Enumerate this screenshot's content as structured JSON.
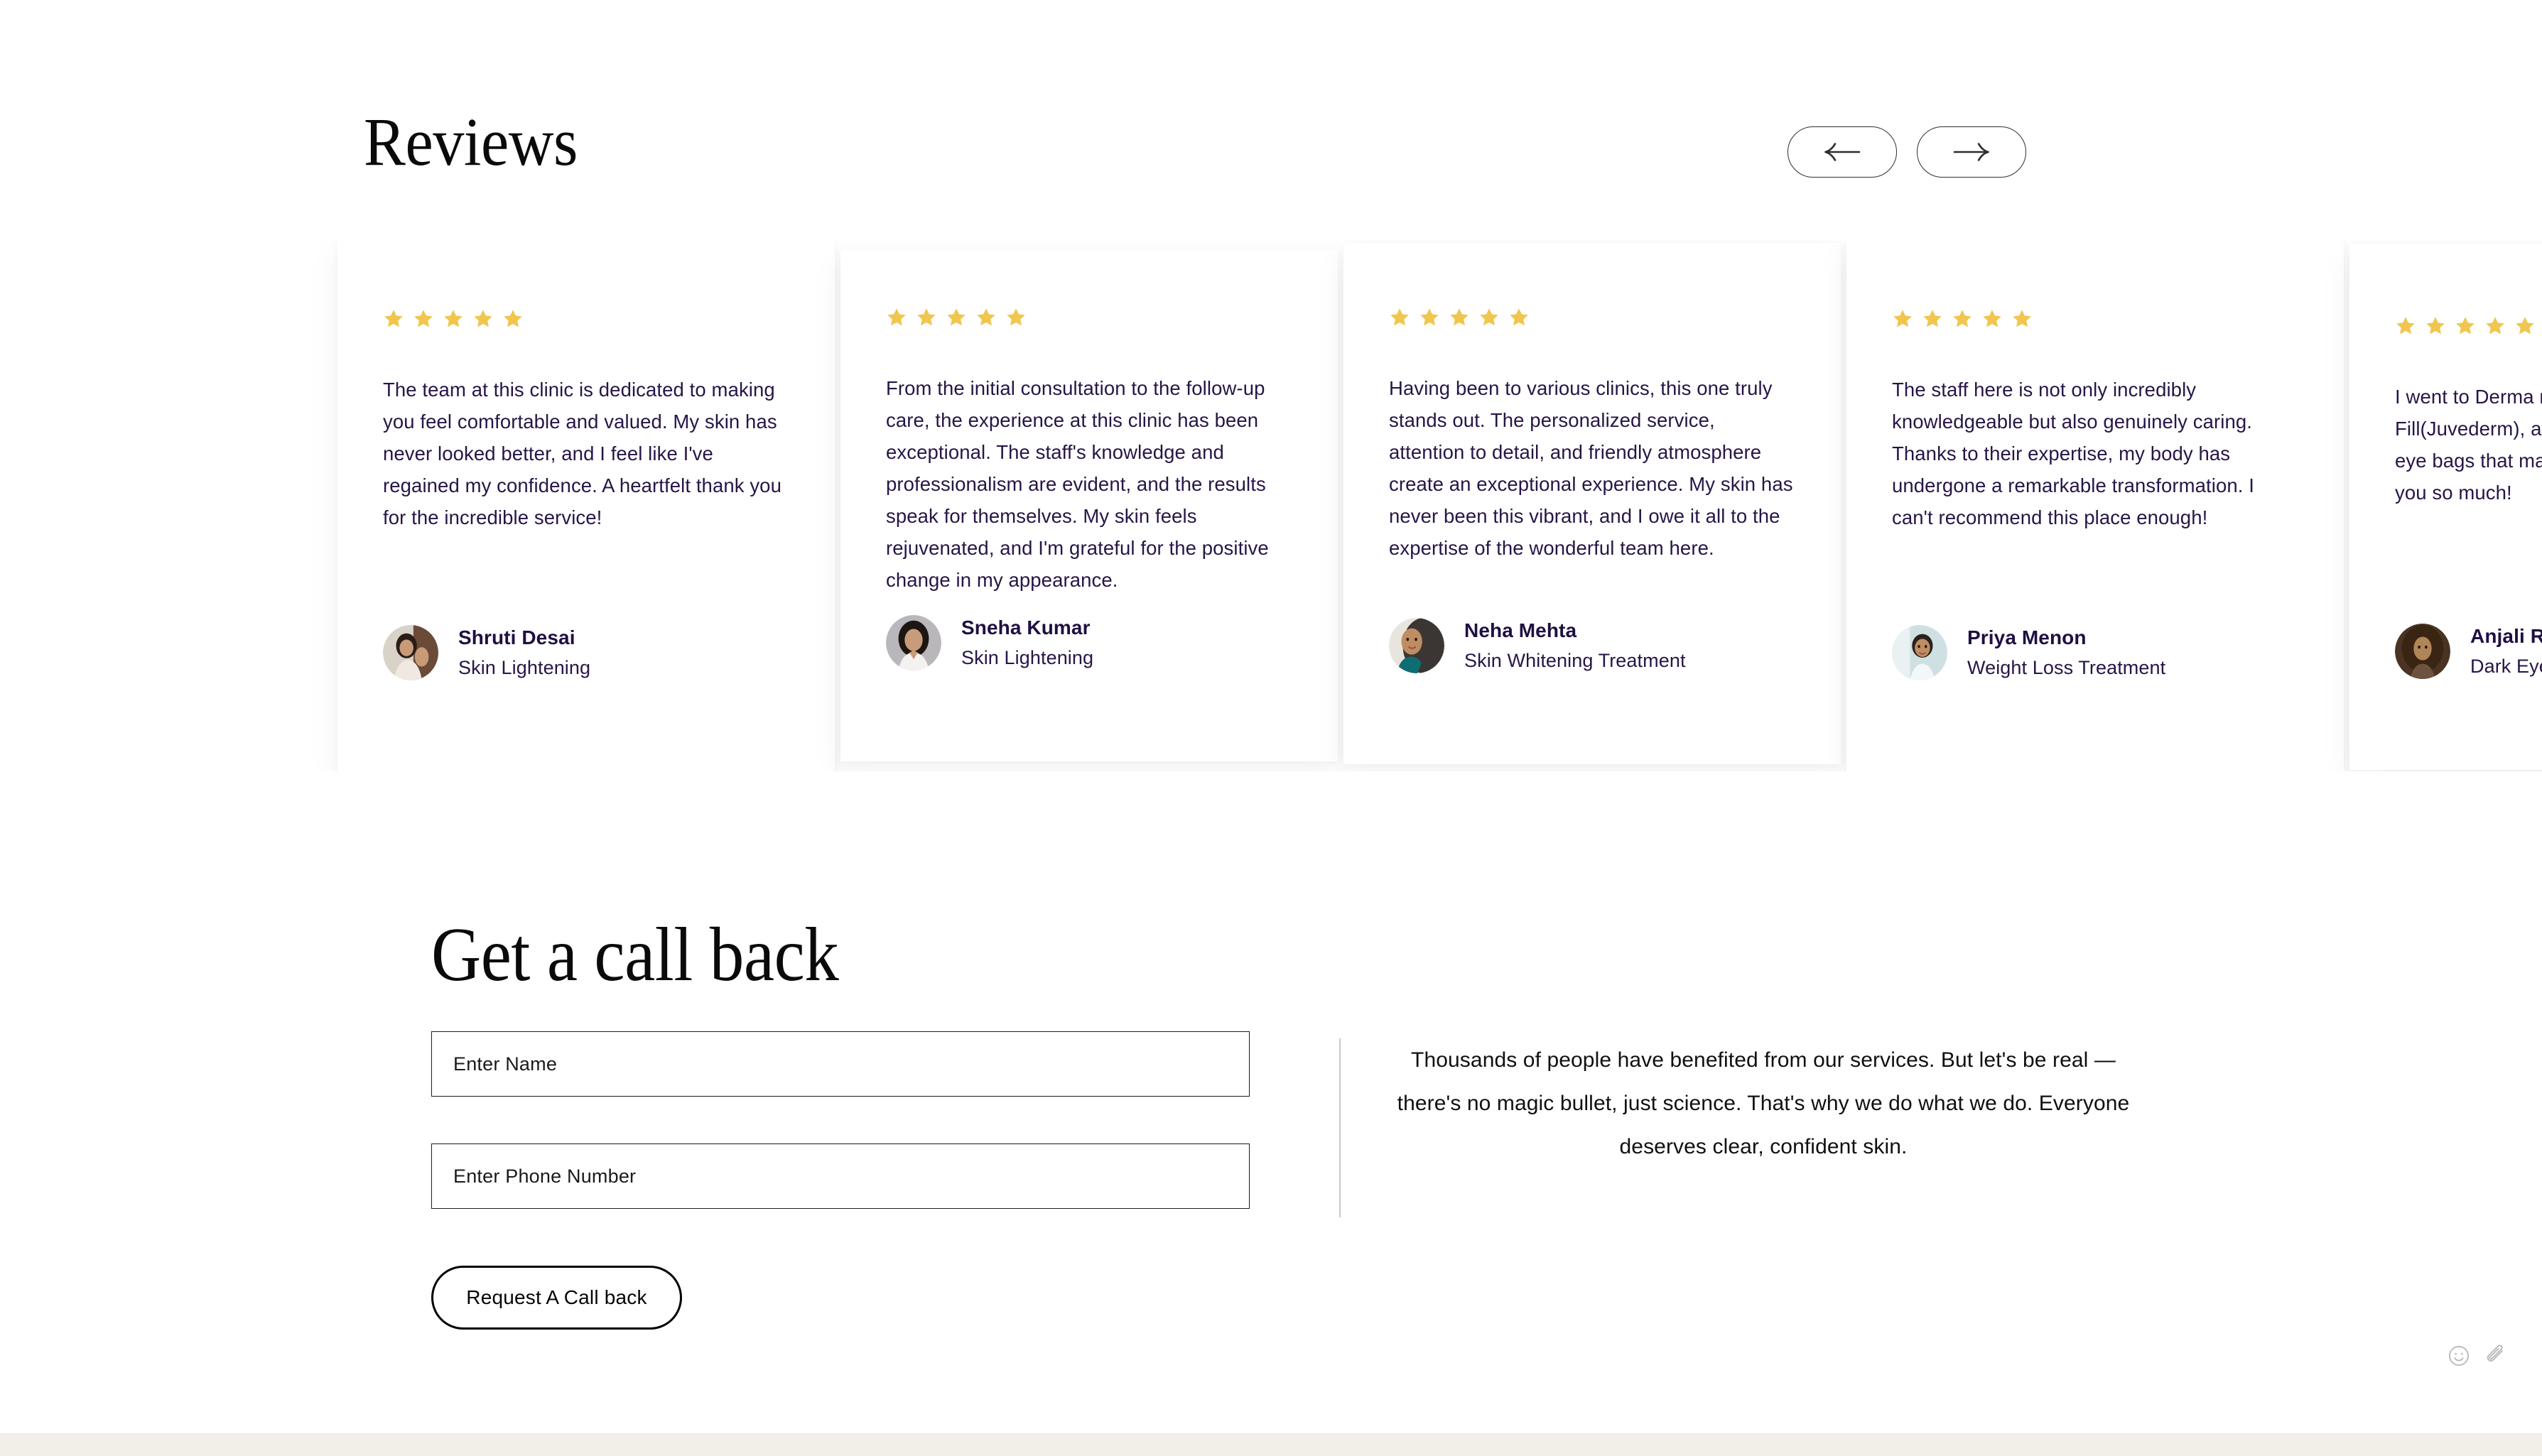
{
  "reviews_section": {
    "title": "Reviews",
    "nav": {
      "prev_label": "Previous review",
      "next_label": "Next review"
    },
    "cards": [
      {
        "stars": 5,
        "text": "The team at this clinic is dedicated to making you feel comfortable and valued. My skin has never looked better, and I feel like I've regained my confidence. A heartfelt thank you for the incredible service!",
        "name": "Shruti Desai",
        "service": "Skin Lightening"
      },
      {
        "stars": 5,
        "text": "From the initial consultation to the follow-up care, the experience at this clinic has been exceptional. The staff's knowledge and professionalism are evident, and the results speak for themselves. My skin feels rejuvenated, and I'm grateful for the positive change in my appearance.",
        "name": "Sneha Kumar",
        "service": "Skin Lightening"
      },
      {
        "stars": 5,
        "text": "Having been to various clinics, this one truly stands out. The personalized service, attention to detail, and friendly atmosphere create an exceptional experience. My skin has never been this vibrant, and I owe it all to the expertise of the wonderful team here.",
        "name": "Neha Mehta",
        "service": "Skin Whitening Treatment"
      },
      {
        "stars": 5,
        "text": "The staff here is not only incredibly knowledgeable but also genuinely caring. Thanks to their expertise, my body has undergone a remarkable transformation. I can't recommend this place enough!",
        "name": "Priya Menon",
        "service": "Weight Loss Treatment"
      },
      {
        "stars": 5,
        "text": "I went to Derma me for Under Eye Fill(Juvederm), and it fixed the hollow under eye bags that made me look so tired. Thank you so much!",
        "name": "Anjali Rao",
        "service": "Dark Eye Circles"
      }
    ]
  },
  "callback_section": {
    "title": "Get a call back",
    "name_placeholder": "Enter Name",
    "name_value": "",
    "phone_placeholder": "Enter Phone Number",
    "phone_value": "",
    "submit_label": "Request A Call back",
    "aside_text": "Thousands of people have benefited from our services. But let's be real — there's no magic bullet, just science. That's why we do what we do. Everyone deserves clear, confident skin."
  },
  "widget": {
    "emoji_icon": "smiley-icon",
    "attach_icon": "paperclip-icon"
  },
  "colors": {
    "star": "#f0c64e",
    "review_text": "#281547",
    "reviewer_name": "#1f0f42",
    "heading": "#0a0a0a",
    "border": "#1c1c1c",
    "divider": "#c9c9c9",
    "bottom_strip": "#f2efe9"
  }
}
